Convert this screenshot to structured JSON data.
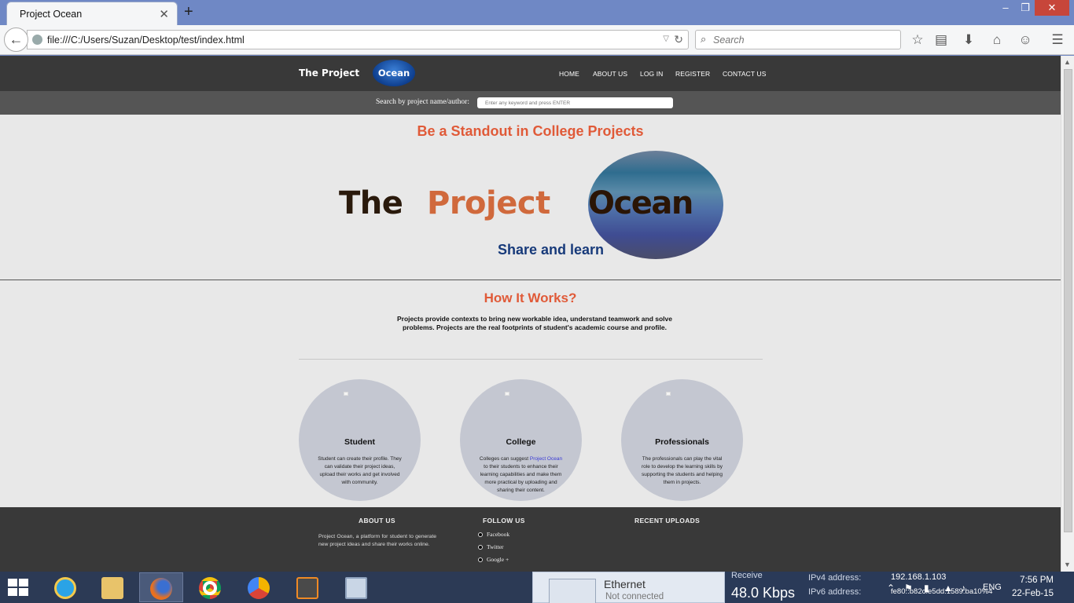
{
  "browser": {
    "tab_title": "Project Ocean",
    "tab_close": "✕",
    "new_tab": "+",
    "url": "file:///C:/Users/Suzan/Desktop/test/index.html",
    "search_placeholder": "Search",
    "window_controls": {
      "minimize": "–",
      "maximize": "❐",
      "close": "✕"
    }
  },
  "site": {
    "logo_text": "The Project",
    "logo_ocean": "Ocean",
    "menu": [
      "HOME",
      "ABOUT US",
      "LOG IN",
      "REGISTER",
      "CONTACT US"
    ],
    "search_label": "Search by project name/author:",
    "search_placeholder": "Enter any keyword and press ENTER",
    "hero_title": "Be a Standout in College Projects",
    "big_logo": {
      "the": "The",
      "project": "Project",
      "ocean": "Ocean",
      "tagline": "Share and learn"
    },
    "how_title": "How It Works?",
    "how_text": "Projects provide contexts to bring new workable idea, understand teamwork and solve problems. Projects are the real footprints of student's academic course and profile.",
    "cards": [
      {
        "title": "Student",
        "text": "Student can create their profile. They can validate their project ideas, upload their works and get involved with community."
      },
      {
        "title": "College",
        "text_before": "Colleges can suggest ",
        "link": "Project Ocean",
        "text_after": " to their students to enhance their learning capabilities and make them more practical by uploading and sharing their content."
      },
      {
        "title": "Professionals",
        "text": "The professionals can play the vital role to develop the learning skills by supporting the students and helping them in projects."
      }
    ],
    "footer": {
      "about_head": "ABOUT US",
      "about_text": "Project Ocean, a platform for student to generate new project ideas and share their works online.",
      "follow_head": "FOLLOW US",
      "follow_items": [
        "Facebook",
        "Twitter",
        "Google +"
      ],
      "recent_head": "RECENT UPLOADS"
    }
  },
  "taskbar": {
    "network": {
      "title": "Ethernet",
      "status": "Not connected",
      "receive_label": "Receive",
      "receive_value": "48.0 Kbps",
      "ipv4_label": "IPv4 address:",
      "ipv4_value": "192.168.1.103",
      "ipv6_label": "IPv6 address:",
      "ipv6_value": "fe80::b82c:e5dd:1589:ba10%4"
    },
    "lang": "ENG",
    "time": "7:56 PM",
    "date": "22-Feb-15"
  },
  "colors": {
    "accent_orange": "#e05a38",
    "header_dark": "#393939",
    "tagline_blue": "#173a7a"
  }
}
